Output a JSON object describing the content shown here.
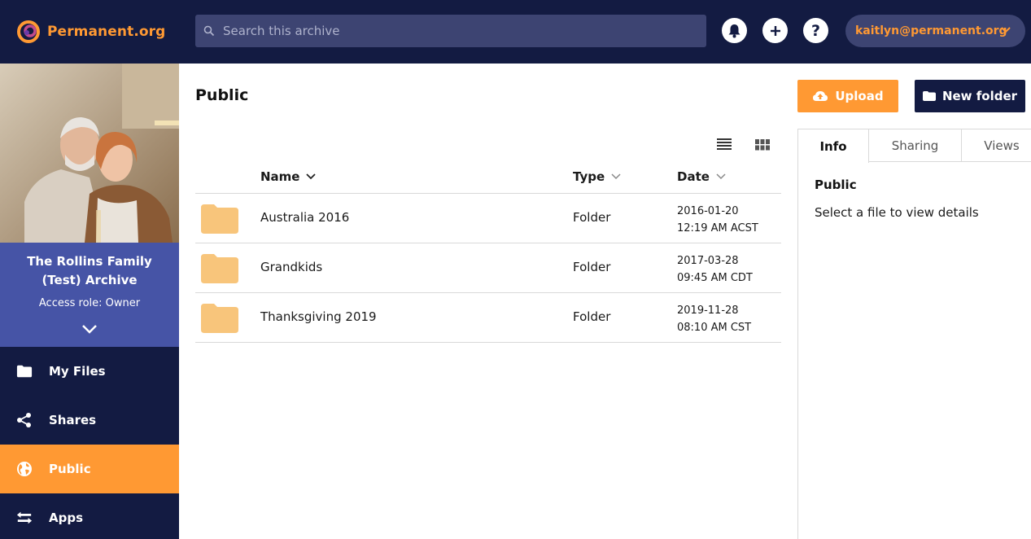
{
  "header": {
    "brand": "Permanent.org",
    "search_placeholder": "Search this archive",
    "user_email": "kaitlyn@permanent.org"
  },
  "archive": {
    "name": "The Rollins Family (Test) Archive",
    "access_role": "Access role: Owner"
  },
  "nav": {
    "my_files": "My Files",
    "shares": "Shares",
    "public": "Public",
    "apps": "Apps"
  },
  "main": {
    "title": "Public",
    "columns": {
      "name": "Name",
      "type": "Type",
      "date": "Date"
    },
    "rows": [
      {
        "name": "Australia 2016",
        "type": "Folder",
        "date": "2016-01-20",
        "time": "12:19 AM ACST"
      },
      {
        "name": "Grandkids",
        "type": "Folder",
        "date": "2017-03-28",
        "time": "09:45 AM CDT"
      },
      {
        "name": "Thanksgiving 2019",
        "type": "Folder",
        "date": "2019-11-28",
        "time": "08:10 AM CST"
      }
    ]
  },
  "actions": {
    "upload": "Upload",
    "new_folder": "New folder"
  },
  "panel": {
    "tabs": {
      "info": "Info",
      "sharing": "Sharing",
      "views": "Views"
    },
    "title": "Public",
    "message": "Select a file to view details"
  },
  "colors": {
    "navy": "#131b42",
    "orange": "#ff9933",
    "purple": "#4654a6",
    "folder": "#f8c57b"
  }
}
